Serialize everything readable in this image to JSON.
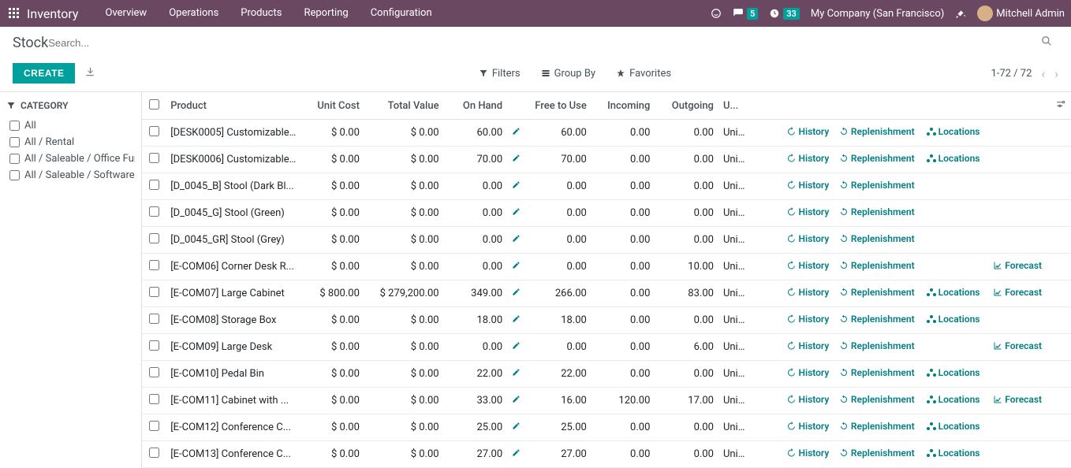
{
  "nav": {
    "brand": "Inventory",
    "menu": [
      "Overview",
      "Operations",
      "Products",
      "Reporting",
      "Configuration"
    ],
    "msg_count": "5",
    "clock_count": "33",
    "company": "My Company (San Francisco)",
    "user": "Mitchell Admin"
  },
  "breadcrumb": "Stock",
  "search_placeholder": "Search...",
  "buttons": {
    "create": "CREATE"
  },
  "filterbar": {
    "filters": "Filters",
    "groupby": "Group By",
    "favorites": "Favorites"
  },
  "pager": "1-72 / 72",
  "sidebar": {
    "heading": "CATEGORY",
    "items": [
      "All",
      "All / Rental",
      "All / Saleable / Office Fur...",
      "All / Saleable / Software"
    ]
  },
  "columns": {
    "product": "Product",
    "unit_cost": "Unit Cost",
    "total_value": "Total Value",
    "on_hand": "On Hand",
    "free": "Free to Use",
    "incoming": "Incoming",
    "outgoing": "Outgoing",
    "uom": "U...",
    "history": "History",
    "replenishment": "Replenishment",
    "locations": "Locations",
    "forecast": "Forecast"
  },
  "rows": [
    {
      "product": "[DESK0005] Customizable...",
      "cost": "$ 0.00",
      "total": "$ 0.00",
      "onhand": "60.00",
      "free": "60.00",
      "in": "0.00",
      "out": "0.00",
      "uom": "Units",
      "loc": true,
      "fc": false
    },
    {
      "product": "[DESK0006] Customizable...",
      "cost": "$ 0.00",
      "total": "$ 0.00",
      "onhand": "70.00",
      "free": "70.00",
      "in": "0.00",
      "out": "0.00",
      "uom": "Units",
      "loc": true,
      "fc": false
    },
    {
      "product": "[D_0045_B] Stool (Dark Bl...",
      "cost": "$ 0.00",
      "total": "$ 0.00",
      "onhand": "0.00",
      "free": "0.00",
      "in": "0.00",
      "out": "0.00",
      "uom": "Units",
      "loc": false,
      "fc": false
    },
    {
      "product": "[D_0045_G] Stool (Green)",
      "cost": "$ 0.00",
      "total": "$ 0.00",
      "onhand": "0.00",
      "free": "0.00",
      "in": "0.00",
      "out": "0.00",
      "uom": "Units",
      "loc": false,
      "fc": false
    },
    {
      "product": "[D_0045_GR] Stool (Grey)",
      "cost": "$ 0.00",
      "total": "$ 0.00",
      "onhand": "0.00",
      "free": "0.00",
      "in": "0.00",
      "out": "0.00",
      "uom": "Units",
      "loc": false,
      "fc": false
    },
    {
      "product": "[E-COM06] Corner Desk R...",
      "cost": "$ 0.00",
      "total": "$ 0.00",
      "onhand": "0.00",
      "free": "0.00",
      "in": "0.00",
      "out": "10.00",
      "uom": "Units",
      "loc": false,
      "fc": true
    },
    {
      "product": "[E-COM07] Large Cabinet",
      "cost": "$ 800.00",
      "total": "$ 279,200.00",
      "onhand": "349.00",
      "free": "266.00",
      "in": "0.00",
      "out": "83.00",
      "uom": "Units",
      "loc": true,
      "fc": true
    },
    {
      "product": "[E-COM08] Storage Box",
      "cost": "$ 0.00",
      "total": "$ 0.00",
      "onhand": "18.00",
      "free": "18.00",
      "in": "0.00",
      "out": "0.00",
      "uom": "Units",
      "loc": true,
      "fc": false
    },
    {
      "product": "[E-COM09] Large Desk",
      "cost": "$ 0.00",
      "total": "$ 0.00",
      "onhand": "0.00",
      "free": "0.00",
      "in": "0.00",
      "out": "6.00",
      "uom": "Units",
      "loc": false,
      "fc": true
    },
    {
      "product": "[E-COM10] Pedal Bin",
      "cost": "$ 0.00",
      "total": "$ 0.00",
      "onhand": "22.00",
      "free": "22.00",
      "in": "0.00",
      "out": "0.00",
      "uom": "Units",
      "loc": true,
      "fc": false
    },
    {
      "product": "[E-COM11] Cabinet with ...",
      "cost": "$ 0.00",
      "total": "$ 0.00",
      "onhand": "33.00",
      "free": "16.00",
      "in": "120.00",
      "out": "17.00",
      "uom": "Units",
      "loc": true,
      "fc": true
    },
    {
      "product": "[E-COM12] Conference C...",
      "cost": "$ 0.00",
      "total": "$ 0.00",
      "onhand": "25.00",
      "free": "25.00",
      "in": "0.00",
      "out": "0.00",
      "uom": "Units",
      "loc": true,
      "fc": false
    },
    {
      "product": "[E-COM13] Conference C...",
      "cost": "$ 0.00",
      "total": "$ 0.00",
      "onhand": "27.00",
      "free": "27.00",
      "in": "0.00",
      "out": "0.00",
      "uom": "Units",
      "loc": true,
      "fc": false
    }
  ]
}
